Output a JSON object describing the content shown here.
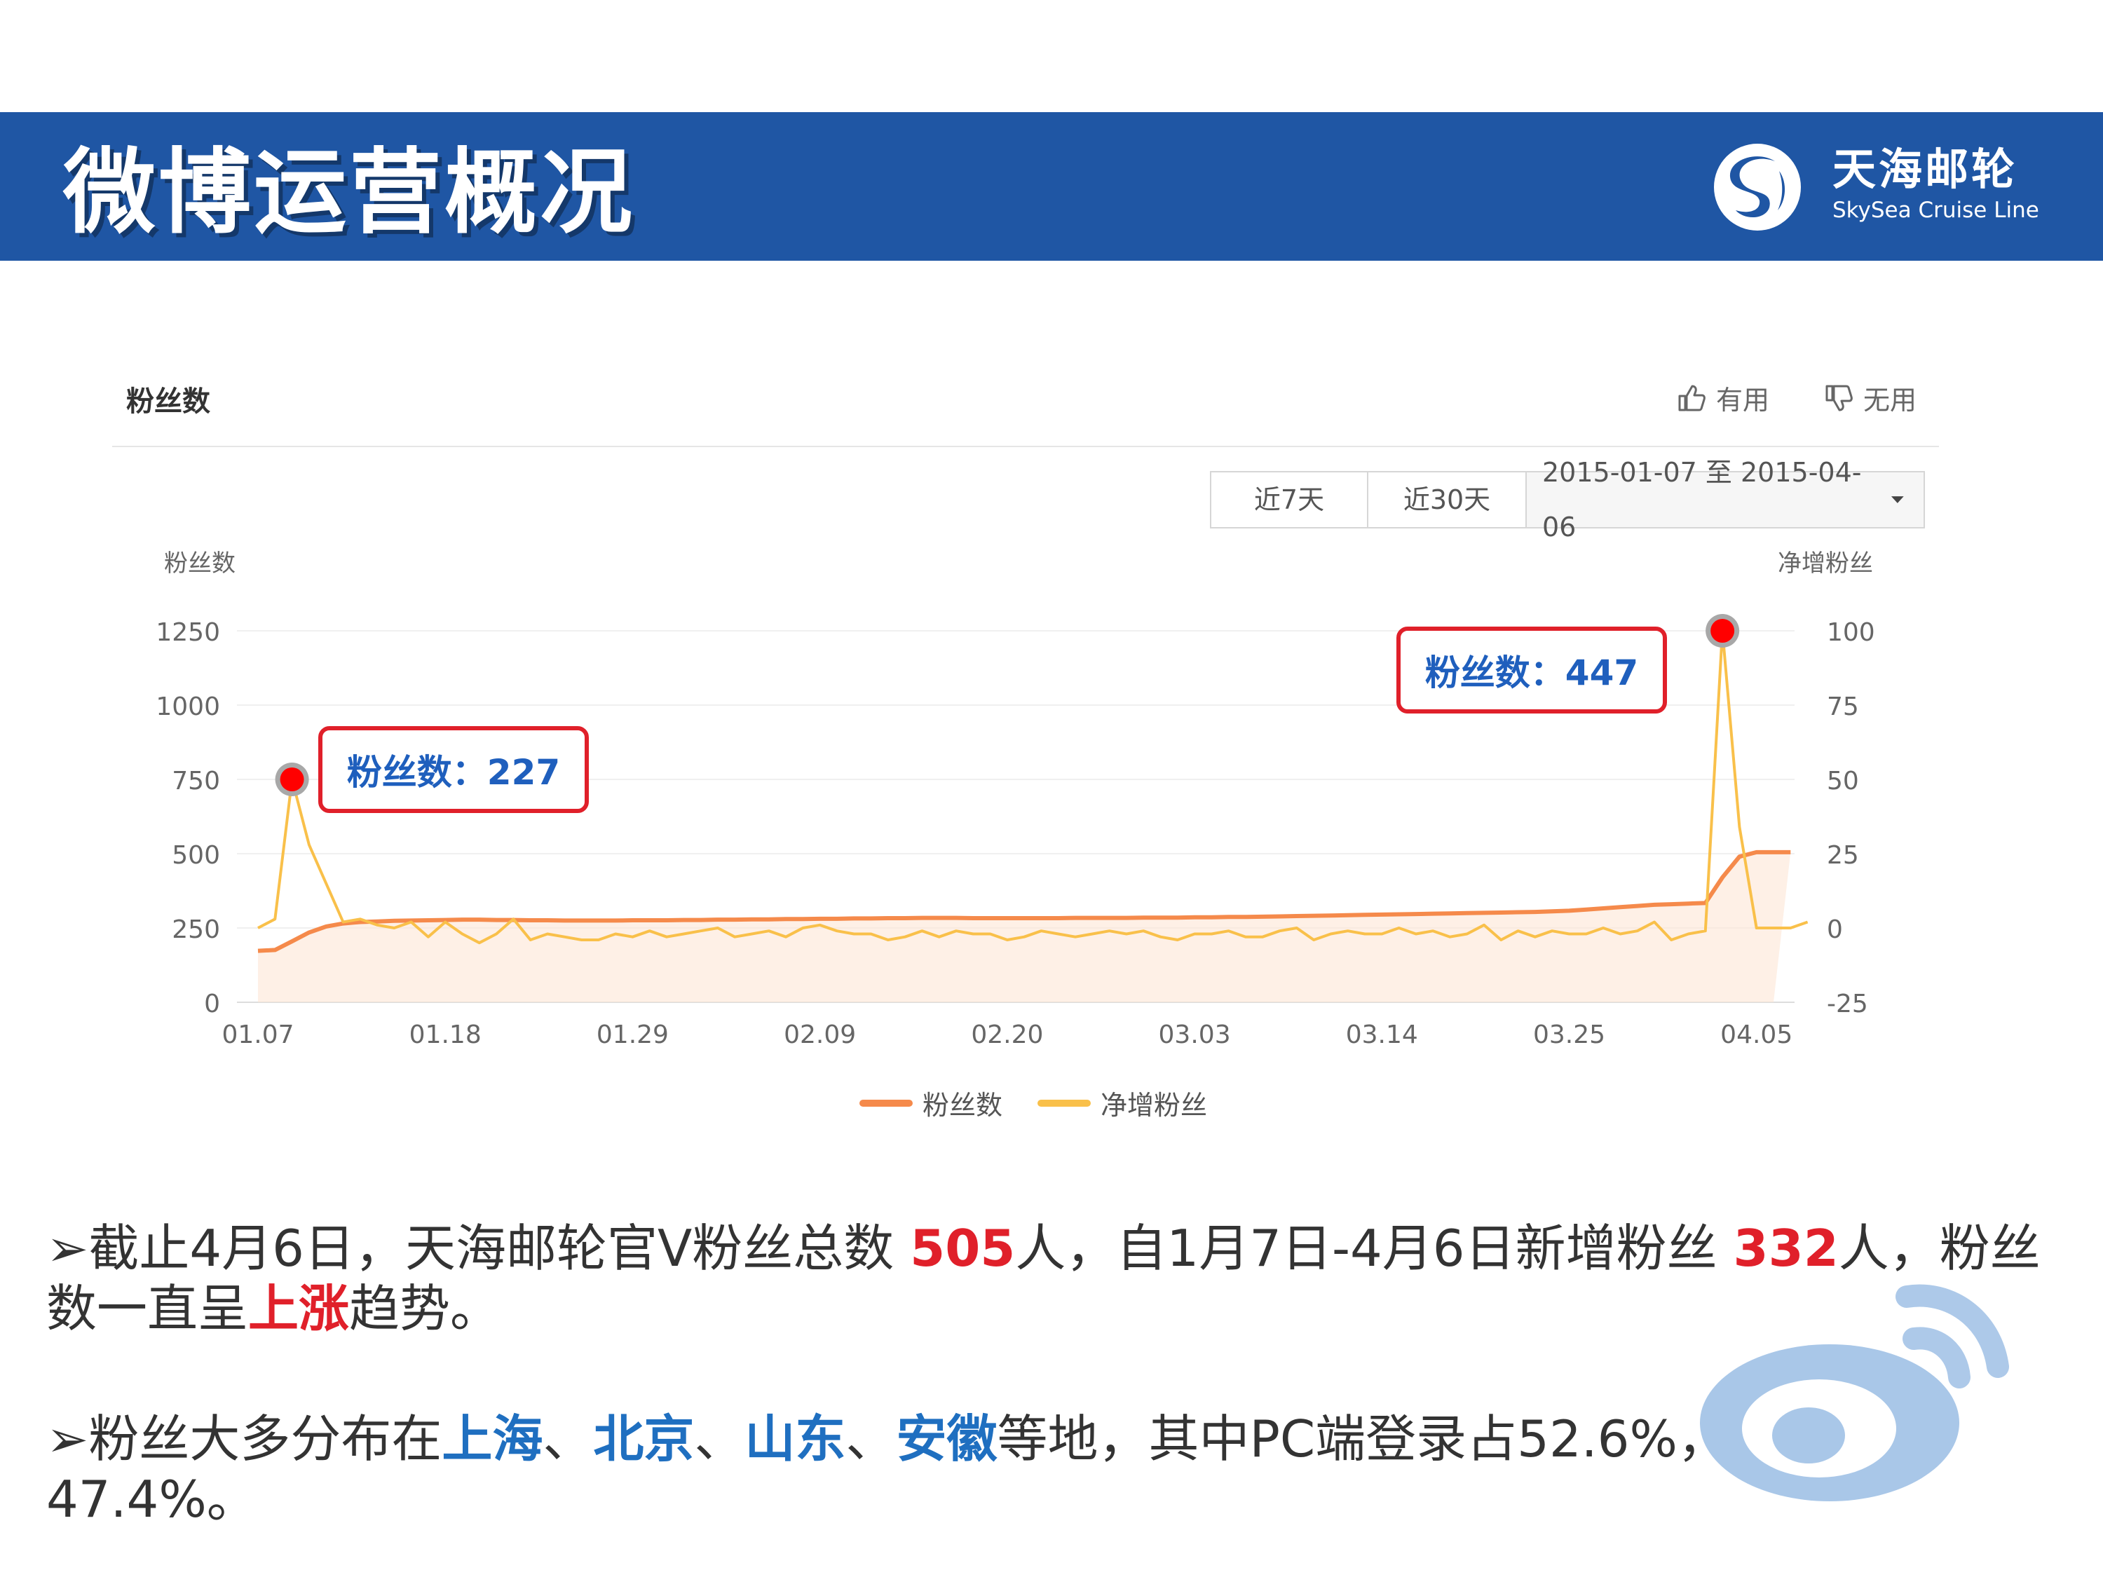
{
  "header": {
    "title": "微博运营概况",
    "brand_cn": "天海邮轮",
    "brand_en": "SkySea Cruise Line",
    "background": "#1f56a4"
  },
  "panel": {
    "title": "粉丝数",
    "useful_label": "有用",
    "useless_label": "无用",
    "range_buttons": [
      "近7天",
      "近30天"
    ],
    "date_range": "2015-01-07 至 2015-04-06",
    "left_axis_title": "粉丝数",
    "right_axis_title": "净增粉丝",
    "legend": [
      {
        "label": "粉丝数",
        "color": "#f58a4b"
      },
      {
        "label": "净增粉丝",
        "color": "#f9c04a"
      }
    ]
  },
  "callouts": [
    {
      "text": "粉丝数：227"
    },
    {
      "text": "粉丝数：447"
    }
  ],
  "chart_data": {
    "type": "line",
    "x": [
      "01.07",
      "01.08",
      "01.09",
      "01.10",
      "01.11",
      "01.12",
      "01.13",
      "01.14",
      "01.15",
      "01.16",
      "01.17",
      "01.18",
      "01.19",
      "01.20",
      "01.21",
      "01.22",
      "01.23",
      "01.24",
      "01.25",
      "01.26",
      "01.27",
      "01.28",
      "01.29",
      "01.30",
      "01.31",
      "02.01",
      "02.02",
      "02.03",
      "02.04",
      "02.05",
      "02.06",
      "02.07",
      "02.08",
      "02.09",
      "02.10",
      "02.11",
      "02.12",
      "02.13",
      "02.14",
      "02.15",
      "02.16",
      "02.17",
      "02.18",
      "02.19",
      "02.20",
      "02.21",
      "02.22",
      "02.23",
      "02.24",
      "02.25",
      "02.26",
      "02.27",
      "02.28",
      "03.01",
      "03.02",
      "03.03",
      "03.04",
      "03.05",
      "03.06",
      "03.07",
      "03.08",
      "03.09",
      "03.10",
      "03.11",
      "03.12",
      "03.13",
      "03.14",
      "03.15",
      "03.16",
      "03.17",
      "03.18",
      "03.19",
      "03.20",
      "03.21",
      "03.22",
      "03.23",
      "03.24",
      "03.25",
      "03.26",
      "03.27",
      "03.28",
      "03.29",
      "03.30",
      "03.31",
      "04.01",
      "04.02",
      "04.03",
      "04.04",
      "04.05",
      "04.06"
    ],
    "x_tick_labels": [
      "01.07",
      "01.18",
      "01.29",
      "02.09",
      "02.20",
      "03.03",
      "03.14",
      "03.25",
      "04.05"
    ],
    "series": [
      {
        "name": "粉丝数",
        "axis": "left",
        "color": "#f58a4b",
        "values": [
          173,
          176,
          205,
          235,
          255,
          265,
          270,
          272,
          274,
          275,
          276,
          277,
          278,
          278,
          277,
          277,
          276,
          276,
          275,
          275,
          275,
          275,
          276,
          276,
          276,
          277,
          277,
          278,
          278,
          279,
          279,
          280,
          280,
          281,
          281,
          282,
          282,
          283,
          283,
          284,
          284,
          284,
          283,
          283,
          283,
          283,
          283,
          283,
          284,
          284,
          284,
          284,
          285,
          285,
          285,
          286,
          286,
          287,
          287,
          288,
          289,
          290,
          291,
          292,
          293,
          294,
          295,
          296,
          297,
          298,
          299,
          300,
          301,
          302,
          303,
          304,
          306,
          308,
          312,
          316,
          320,
          324,
          328,
          330,
          332,
          334,
          420,
          490,
          505,
          505,
          505
        ]
      },
      {
        "name": "净增粉丝",
        "axis": "right",
        "color": "#f9c04a",
        "values": [
          0,
          3,
          50,
          28,
          15,
          2,
          3,
          1,
          0,
          2,
          -3,
          2,
          -2,
          -5,
          -2,
          3,
          -4,
          -2,
          -3,
          -4,
          -4,
          -2,
          -3,
          -1,
          -3,
          -2,
          -1,
          0,
          -3,
          -2,
          -1,
          -3,
          0,
          1,
          -1,
          -2,
          -2,
          -4,
          -3,
          -1,
          -3,
          -1,
          -2,
          -2,
          -4,
          -3,
          -1,
          -2,
          -3,
          -2,
          -1,
          -2,
          -1,
          -3,
          -4,
          -2,
          -2,
          -1,
          -3,
          -3,
          -1,
          0,
          -4,
          -2,
          -1,
          -2,
          -2,
          0,
          -2,
          -1,
          -3,
          -2,
          1,
          -4,
          -1,
          -3,
          -1,
          -2,
          -2,
          0,
          -2,
          -1,
          2,
          -4,
          -2,
          -1,
          100,
          34,
          0,
          0,
          0,
          2
        ]
      }
    ],
    "left_ylim": [
      0,
      1250
    ],
    "right_ylim": [
      -25,
      100
    ],
    "left_ticks": [
      0,
      250,
      500,
      750,
      1000,
      1250
    ],
    "right_ticks": [
      -25,
      0,
      25,
      50,
      75,
      100
    ],
    "annotations": [
      "粉丝数：227",
      "粉丝数：447"
    ],
    "grid": true,
    "legend_position": "bottom"
  },
  "body_text": {
    "p1": [
      {
        "text": "➢截止4月6日，天海邮轮官V粉丝总数 ",
        "style": "normal"
      },
      {
        "text": "505",
        "style": "red"
      },
      {
        "text": "人，自1月7日-4月6日新增粉丝 ",
        "style": "normal"
      },
      {
        "text": "332",
        "style": "red"
      },
      {
        "text": "人，粉丝数一直呈",
        "style": "normal"
      },
      {
        "text": "上涨",
        "style": "red"
      },
      {
        "text": "趋势。",
        "style": "normal"
      }
    ],
    "p2": [
      {
        "text": "➢粉丝大多分布在",
        "style": "normal"
      },
      {
        "text": "上海",
        "style": "blue"
      },
      {
        "text": "、",
        "style": "normal"
      },
      {
        "text": "北京",
        "style": "blue"
      },
      {
        "text": "、",
        "style": "normal"
      },
      {
        "text": "山东",
        "style": "blue"
      },
      {
        "text": "、",
        "style": "normal"
      },
      {
        "text": "安徽",
        "style": "blue"
      },
      {
        "text": "等地，其中PC端登录占52.6%，移动端占47.4%。",
        "style": "normal"
      }
    ]
  }
}
